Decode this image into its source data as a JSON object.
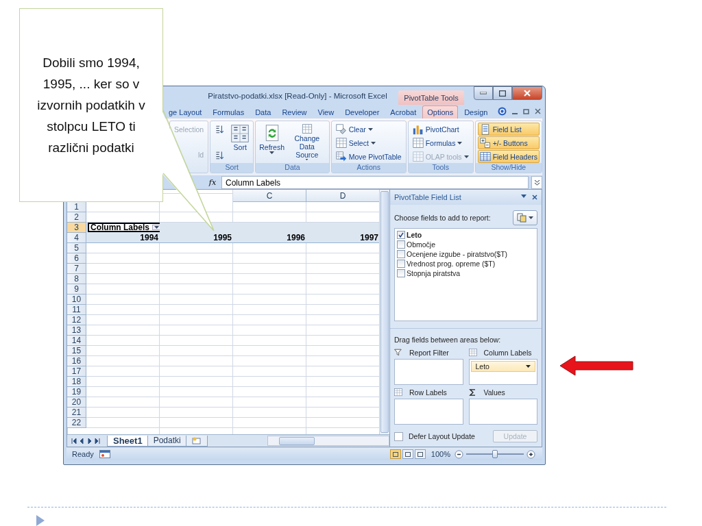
{
  "callout": {
    "text": "Dobili smo 1994, 1995, ... ker so v izvornih podatkih v stolpcu LETO ti različni podatki"
  },
  "window": {
    "title": "Piratstvo-podatki.xlsx  [Read-Only] - Microsoft Excel",
    "context_tab_group": "PivotTable Tools"
  },
  "ribbon_tabs": [
    {
      "label": "ge Layout",
      "selected": false
    },
    {
      "label": "Formulas",
      "selected": false
    },
    {
      "label": "Data",
      "selected": false
    },
    {
      "label": "Review",
      "selected": false
    },
    {
      "label": "View",
      "selected": false
    },
    {
      "label": "Developer",
      "selected": false
    },
    {
      "label": "Acrobat",
      "selected": false
    },
    {
      "label": "Options",
      "selected": true
    },
    {
      "label": "Design",
      "selected": false
    }
  ],
  "ribbon_groups": [
    {
      "commands": [
        {
          "label": "Selection",
          "kind": "small",
          "disabled": true,
          "on": false,
          "menu": false
        },
        {
          "label": "ld",
          "kind": "small",
          "disabled": true,
          "on": false,
          "menu": false
        }
      ]
    },
    {
      "label": "Sort",
      "commands": [
        {
          "kind": "icon",
          "disabled": false,
          "on": false,
          "menu": false
        },
        {
          "kind": "icon",
          "disabled": false,
          "on": false,
          "menu": false
        },
        {
          "label": "Sort",
          "kind": "large",
          "disabled": false,
          "on": false,
          "menu": false
        }
      ]
    },
    {
      "label": "Data",
      "commands": [
        {
          "label": "Refresh",
          "kind": "large",
          "disabled": false,
          "on": false,
          "menu": true
        },
        {
          "label": "Change Data Source",
          "kind": "large",
          "disabled": false,
          "on": false,
          "menu": true
        }
      ]
    },
    {
      "label": "Actions",
      "commands": [
        {
          "label": "Clear",
          "kind": "small",
          "disabled": false,
          "on": false,
          "menu": true
        },
        {
          "label": "Select",
          "kind": "small",
          "disabled": false,
          "on": false,
          "menu": true
        },
        {
          "label": "Move PivotTable",
          "kind": "small",
          "disabled": false,
          "on": false,
          "menu": false
        }
      ]
    },
    {
      "label": "Tools",
      "commands": [
        {
          "label": "PivotChart",
          "kind": "small",
          "disabled": false,
          "on": false,
          "menu": false
        },
        {
          "label": "Formulas",
          "kind": "small",
          "disabled": false,
          "on": false,
          "menu": true
        },
        {
          "label": "OLAP tools",
          "kind": "small",
          "disabled": true,
          "on": false,
          "menu": true
        }
      ]
    },
    {
      "label": "Show/Hide",
      "commands": [
        {
          "label": "Field List",
          "kind": "small",
          "disabled": false,
          "on": true,
          "menu": false
        },
        {
          "label": "+/- Buttons",
          "kind": "small",
          "disabled": false,
          "on": true,
          "menu": false
        },
        {
          "label": "Field Headers",
          "kind": "small",
          "disabled": false,
          "on": true,
          "menu": false
        }
      ]
    }
  ],
  "formula_bar": {
    "function_label": "fx",
    "value": "Column Labels"
  },
  "column_headers": [
    "C",
    "D"
  ],
  "rows": [
    {
      "number": "1",
      "selected": false,
      "kind": "blank"
    },
    {
      "number": "2",
      "selected": false,
      "kind": "blank"
    },
    {
      "number": "3",
      "selected": true,
      "kind": "pivot_filter",
      "cells": [
        "Column Labels"
      ]
    },
    {
      "number": "4",
      "selected": false,
      "kind": "pivot_values",
      "cells": [
        "1994",
        "1995",
        "1996",
        "1997"
      ]
    },
    {
      "number": "5",
      "selected": false,
      "kind": "blank"
    },
    {
      "number": "6",
      "selected": false,
      "kind": "blank"
    },
    {
      "number": "7",
      "selected": false,
      "kind": "blank"
    },
    {
      "number": "8",
      "selected": false,
      "kind": "blank"
    },
    {
      "number": "9",
      "selected": false,
      "kind": "blank"
    },
    {
      "number": "10",
      "selected": false,
      "kind": "blank"
    },
    {
      "number": "11",
      "selected": false,
      "kind": "blank"
    },
    {
      "number": "12",
      "selected": false,
      "kind": "blank"
    },
    {
      "number": "13",
      "selected": false,
      "kind": "blank"
    },
    {
      "number": "14",
      "selected": false,
      "kind": "blank"
    },
    {
      "number": "15",
      "selected": false,
      "kind": "blank"
    },
    {
      "number": "16",
      "selected": false,
      "kind": "blank"
    },
    {
      "number": "17",
      "selected": false,
      "kind": "blank"
    },
    {
      "number": "18",
      "selected": false,
      "kind": "blank"
    },
    {
      "number": "19",
      "selected": false,
      "kind": "blank"
    },
    {
      "number": "20",
      "selected": false,
      "kind": "blank"
    },
    {
      "number": "21",
      "selected": false,
      "kind": "blank"
    },
    {
      "number": "22",
      "selected": false,
      "kind": "blank"
    }
  ],
  "sheet_tabs": [
    {
      "label": "Sheet1",
      "selected": true
    },
    {
      "label": "Podatki",
      "selected": false
    }
  ],
  "field_list": {
    "title": "PivotTable Field List",
    "prompt": "Choose fields to add to report:",
    "fields": [
      {
        "label": "Leto",
        "checked": true
      },
      {
        "label": "Območje",
        "checked": false
      },
      {
        "label": "Ocenjene izgube - piratstvo($T)",
        "checked": false
      },
      {
        "label": "Vrednost prog. opreme ($T)",
        "checked": false
      },
      {
        "label": "Stopnja piratstva",
        "checked": false
      }
    ],
    "areas_prompt": "Drag fields between areas below:",
    "areas": [
      {
        "label": "Report Filter"
      },
      {
        "label": "Column Labels",
        "items": [
          "Leto"
        ]
      },
      {
        "label": "Row Labels"
      },
      {
        "label": "Values"
      }
    ],
    "defer": {
      "label": "Defer Layout Update",
      "checked": false
    },
    "update": {
      "label": "Update",
      "disabled": true
    }
  },
  "status_bar": {
    "text": "Ready",
    "view_buttons": [
      {
        "selected": true
      },
      {
        "selected": false
      },
      {
        "selected": false
      }
    ],
    "zoom": {
      "label": "100%",
      "level": 0.5
    }
  }
}
